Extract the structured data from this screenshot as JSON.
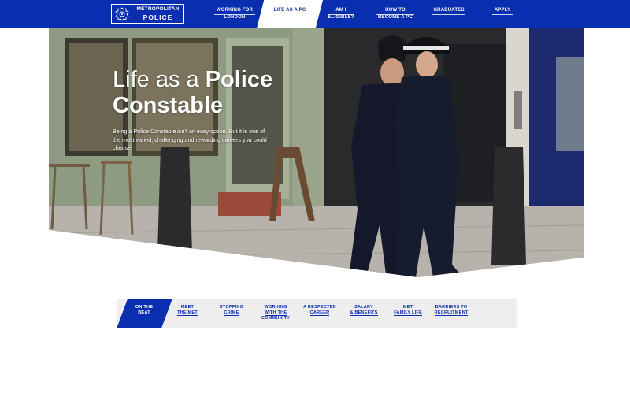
{
  "header": {
    "logo": {
      "line1": "METROPOLITAN",
      "line2": "POLICE",
      "icon": "crest-icon"
    },
    "nav": [
      {
        "label": "WORKING FOR LONDON",
        "line1": "WORKING FOR",
        "line2": "LONDON"
      },
      {
        "label": "LIFE AS A PC",
        "active": true
      },
      {
        "label": "AM I ELIGIBLE?",
        "line1": "AM I",
        "line2": "ELIGIBLE?"
      },
      {
        "label": "HOW TO BECOME A PC",
        "line1": "HOW TO",
        "line2": "BECOME A PC"
      },
      {
        "label": "GRADUATES"
      },
      {
        "label": "APPLY"
      }
    ],
    "colors": {
      "brand": "#0a2eb0",
      "active_tab_bg": "#ffffff"
    }
  },
  "hero": {
    "title_light": "Life as a ",
    "title_bold1": "Police",
    "title_bold2": "Constable",
    "description": "Being a Police Constable isn't an easy option. But it is one of the most varied, challenging and rewarding careers you could choose."
  },
  "subnav": {
    "tabs": [
      {
        "line1": "ON THE",
        "line2": "BEAT",
        "active": true
      },
      {
        "line1": "MEET",
        "line2": "THE MET"
      },
      {
        "line1": "STOPPING",
        "line2": "CRIME"
      },
      {
        "line1": "WORKING",
        "line2": "WITH THE",
        "line3": "COMMUNITY"
      },
      {
        "line1": "A RESPECTED",
        "line2": "CAREER"
      },
      {
        "line1": "SALARY",
        "line2": "& BENEFITS"
      },
      {
        "line1": "MET",
        "line2": "FAMILY LIFE"
      },
      {
        "line1": "BARRIERS TO",
        "line2": "RECRUITMENT"
      }
    ]
  }
}
